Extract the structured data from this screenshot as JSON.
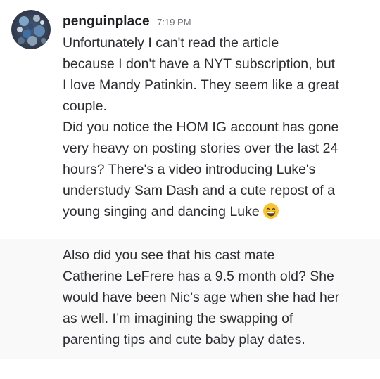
{
  "messages": [
    {
      "author": "penguinplace",
      "timestamp": "7:19 PM",
      "lines": [
        "Unfortunately I can't read the article",
        "because I don't have a NYT subscription, but",
        "I love Mandy Patinkin. They seem like a great",
        "couple.",
        "Did you notice the HOM IG account has gone",
        "very heavy on posting stories over the last 24",
        "hours? There's a video introducing Luke's",
        "understudy Sam Dash and a cute repost of a",
        "young singing and dancing Luke"
      ],
      "trailing_emoji": "grinning-face-with-smiling-eyes"
    },
    {
      "lines": [
        "Also did you see that his cast mate",
        "Catherine LeFrere has a 9.5 month old? She",
        "would have been Nic’s age when she had her",
        "as well. I’m imagining the swapping of",
        "parenting tips and cute baby play dates."
      ]
    }
  ],
  "colors": {
    "username": "#1e1f22",
    "timestamp": "#6c6f75",
    "message_text": "#2b2d31",
    "hover_background": "#f9f9fa",
    "emoji_face": "#f7c533"
  }
}
